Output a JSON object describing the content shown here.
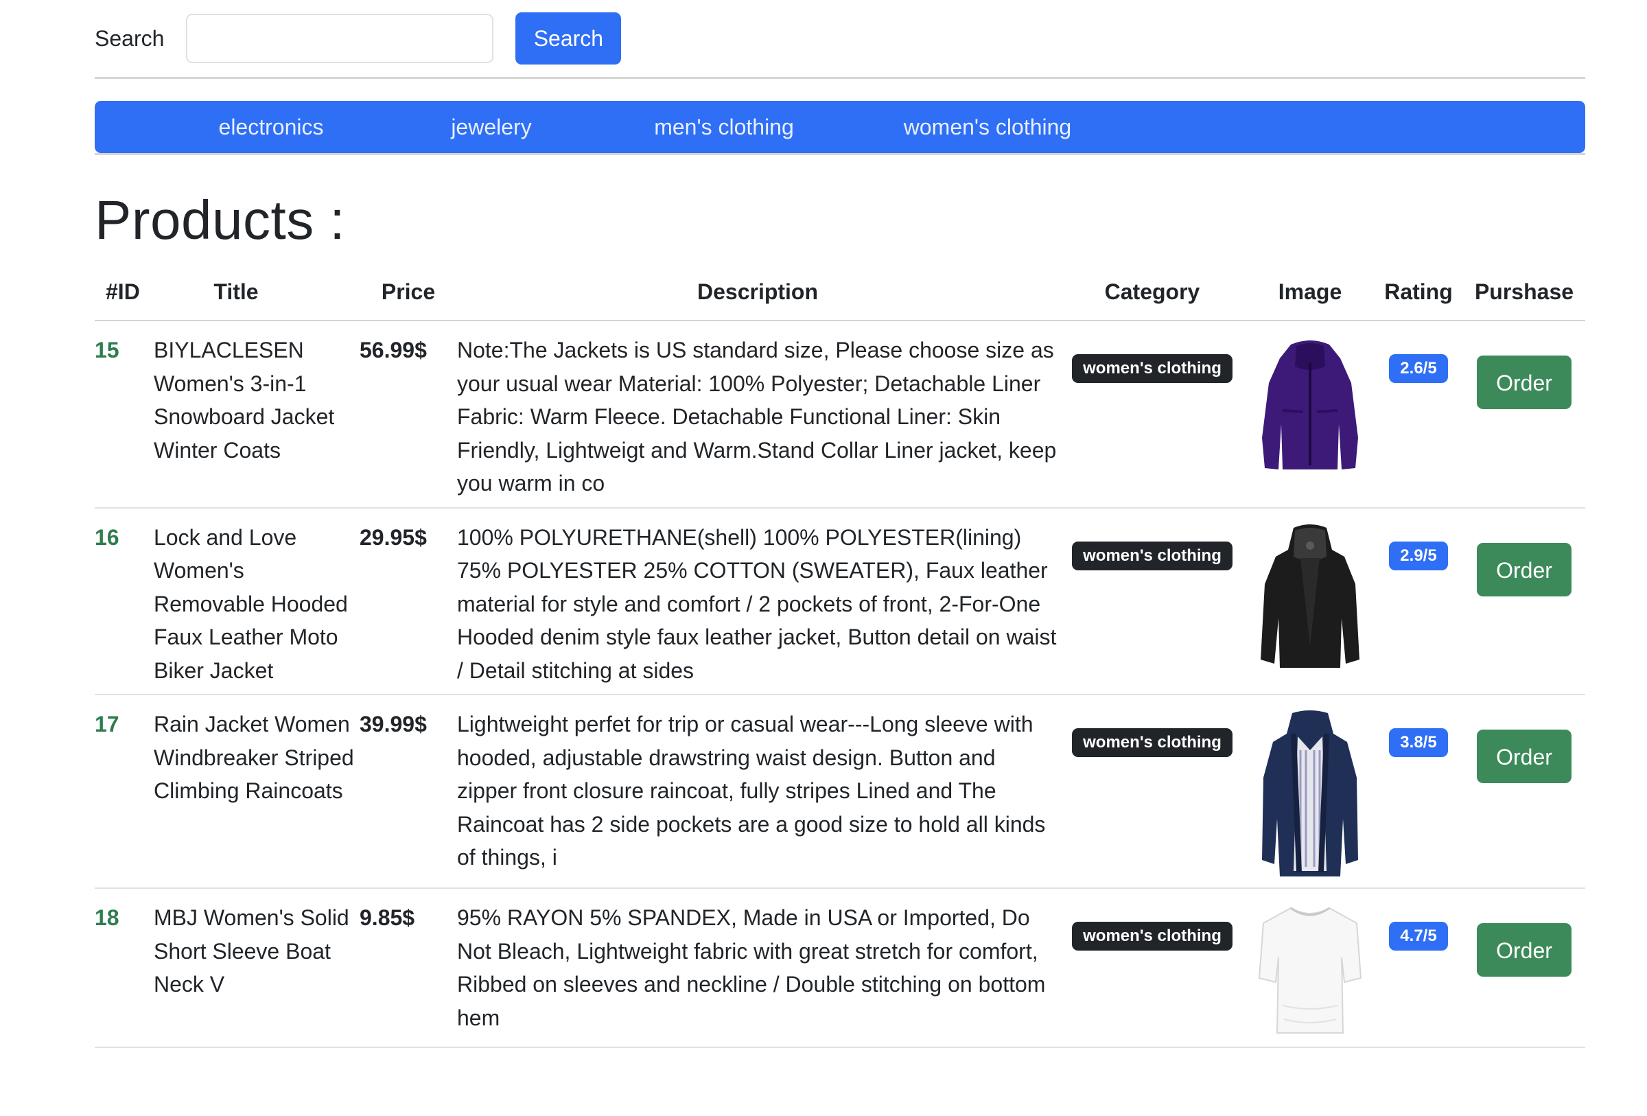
{
  "search": {
    "label": "Search",
    "value": "",
    "placeholder": "",
    "button_label": "Search"
  },
  "categories": [
    "electronics",
    "jewelery",
    "men's clothing",
    "women's clothing"
  ],
  "page_title": "Products :",
  "table": {
    "headers": [
      "#ID",
      "Title",
      "Price",
      "Description",
      "Category",
      "Image",
      "Rating",
      "Purshase"
    ],
    "rows": [
      {
        "id": "15",
        "title": "BIYLACLESEN Women's 3-in-1 Snowboard Jacket Winter Coats",
        "price": "56.99$",
        "description": "Note:The Jackets is US standard size, Please choose size as your usual wear Material: 100% Polyester; Detachable Liner Fabric: Warm Fleece. Detachable Functional Liner: Skin Friendly, Lightweigt and Warm.Stand Collar Liner jacket, keep you warm in co",
        "category": "women's clothing",
        "image": "purple-winter-jacket",
        "rating": "2.6/5",
        "order_label": "Order"
      },
      {
        "id": "16",
        "title": "Lock and Love Women's Removable Hooded Faux Leather Moto Biker Jacket",
        "price": "29.95$",
        "description": "100% POLYURETHANE(shell) 100% POLYESTER(lining) 75% POLYESTER 25% COTTON (SWEATER), Faux leather material for style and comfort / 2 pockets of front, 2-For-One Hooded denim style faux leather jacket, Button detail on waist / Detail stitching at sides",
        "category": "women's clothing",
        "image": "black-leather-jacket",
        "rating": "2.9/5",
        "order_label": "Order"
      },
      {
        "id": "17",
        "title": "Rain Jacket Women Windbreaker Striped Climbing Raincoats",
        "price": "39.99$",
        "description": "Lightweight perfet for trip or casual wear---Long sleeve with hooded, adjustable drawstring waist design. Button and zipper front closure raincoat, fully stripes Lined and The Raincoat has 2 side pockets are a good size to hold all kinds of things, i",
        "category": "women's clothing",
        "image": "navy-raincoat",
        "rating": "3.8/5",
        "order_label": "Order"
      },
      {
        "id": "18",
        "title": "MBJ Women's Solid Short Sleeve Boat Neck V",
        "price": "9.85$",
        "description": "95% RAYON 5% SPANDEX, Made in USA or Imported, Do Not Bleach, Lightweight fabric with great stretch for comfort, Ribbed on sleeves and neckline / Double stitching on bottom hem",
        "category": "women's clothing",
        "image": "white-short-sleeve-top",
        "rating": "4.7/5",
        "order_label": "Order"
      }
    ]
  },
  "colors": {
    "primary": "#2f6ff5",
    "success": "#3c8a5a",
    "id_green": "#2e7d4f",
    "dark_badge": "#212529"
  }
}
